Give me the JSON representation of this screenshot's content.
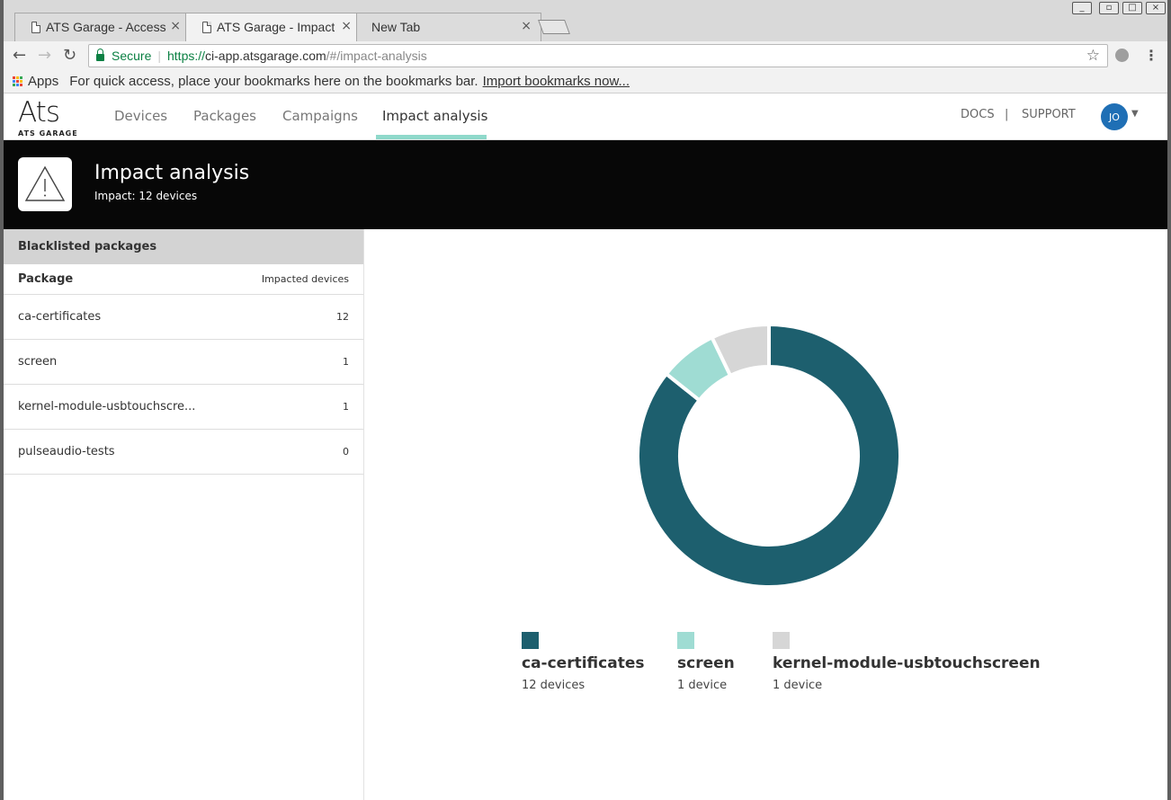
{
  "browser": {
    "tabs": [
      {
        "title": "ATS Garage - Access",
        "close": "×"
      },
      {
        "title": "ATS Garage - Impact",
        "close": "×"
      },
      {
        "title": "New Tab",
        "close": "×"
      }
    ],
    "url": {
      "secure_label": "Secure",
      "scheme": "https://",
      "host": "ci-app.atsgarage.com",
      "path": "/#/impact-analysis"
    },
    "bookmarks": {
      "apps_label": "Apps",
      "hint": "For quick access, place your bookmarks here on the bookmarks bar.",
      "import_label": "Import bookmarks now..."
    }
  },
  "app": {
    "logo_main": "Ats",
    "logo_sub": "ATS GARAGE",
    "nav": [
      "Devices",
      "Packages",
      "Campaigns",
      "Impact analysis"
    ],
    "active_nav": "Impact analysis",
    "docs_label": "DOCS",
    "separator": "|",
    "support_label": "SUPPORT",
    "avatar_initials": "JO"
  },
  "hero": {
    "title": "Impact analysis",
    "subtitle": "Impact: 12 devices"
  },
  "packages_panel": {
    "heading": "Blacklisted packages",
    "col_package": "Package",
    "col_impacted": "Impacted devices",
    "rows": [
      {
        "name": "ca-certificates",
        "count": "12"
      },
      {
        "name": "screen",
        "count": "1"
      },
      {
        "name": "kernel-module-usbtouchscre...",
        "count": "1"
      },
      {
        "name": "pulseaudio-tests",
        "count": "0"
      }
    ]
  },
  "chart_data": {
    "type": "pie",
    "donut": true,
    "categories": [
      "ca-certificates",
      "screen",
      "kernel-module-usbtouchscreen"
    ],
    "values": [
      12,
      1,
      1
    ],
    "value_labels": [
      "12 devices",
      "1 device",
      "1 device"
    ],
    "colors": [
      "#1d5f6e",
      "#9fdcd3",
      "#d6d6d6"
    ],
    "legend_position": "bottom"
  }
}
